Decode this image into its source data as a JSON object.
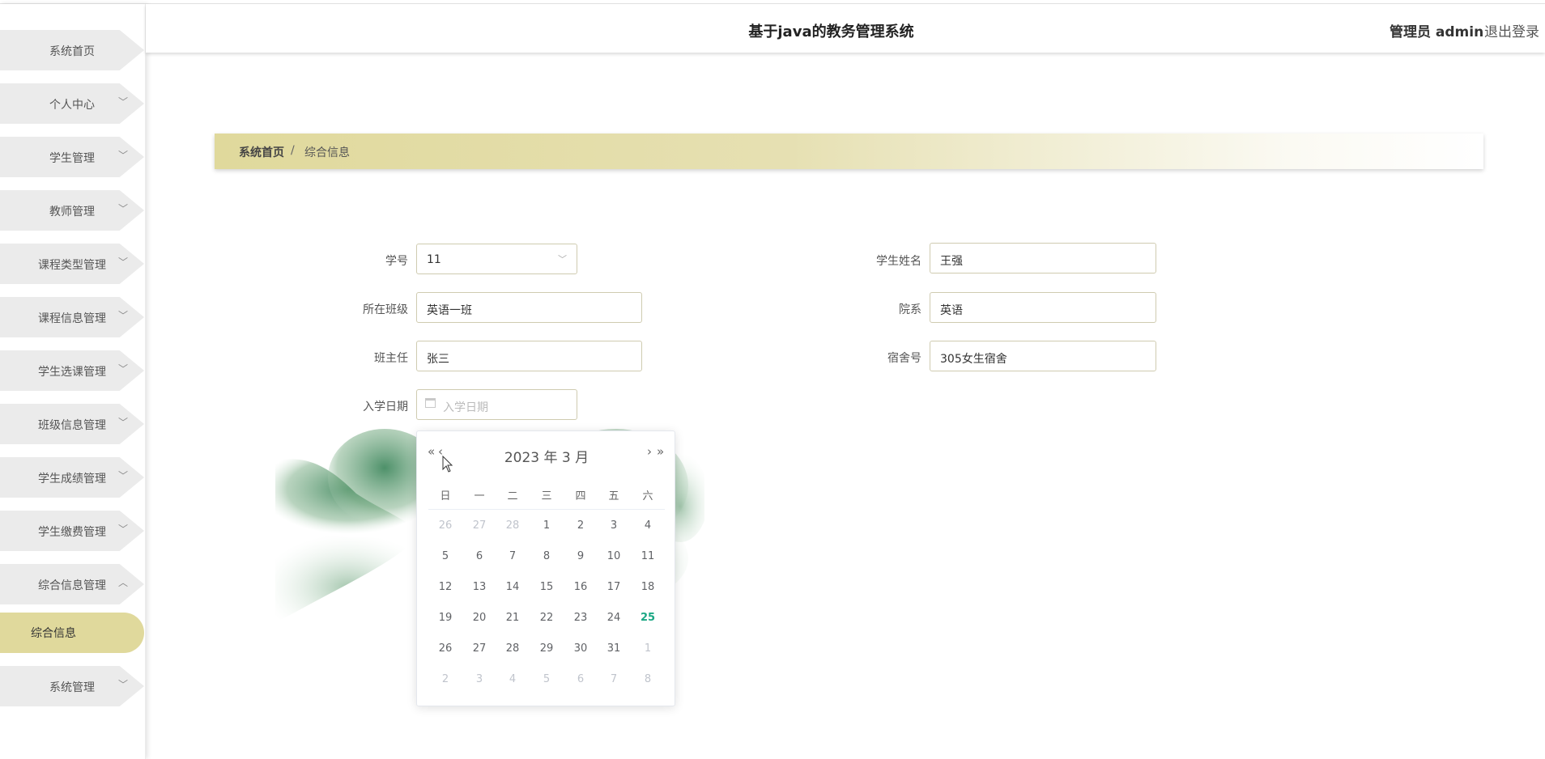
{
  "header": {
    "title": "基于java的教务管理系统",
    "user": "管理员 admin",
    "logout": "退出登录"
  },
  "sidebar": {
    "items": [
      {
        "label": "系统首页",
        "chevron": ""
      },
      {
        "label": "个人中心",
        "chevron": "﹀"
      },
      {
        "label": "学生管理",
        "chevron": "﹀"
      },
      {
        "label": "教师管理",
        "chevron": "﹀"
      },
      {
        "label": "课程类型管理",
        "chevron": "﹀"
      },
      {
        "label": "课程信息管理",
        "chevron": "﹀"
      },
      {
        "label": "学生选课管理",
        "chevron": "﹀"
      },
      {
        "label": "班级信息管理",
        "chevron": "﹀"
      },
      {
        "label": "学生成绩管理",
        "chevron": "﹀"
      },
      {
        "label": "学生缴费管理",
        "chevron": "﹀"
      },
      {
        "label": "综合信息管理",
        "chevron": "︿"
      },
      {
        "label": "系统管理",
        "chevron": "﹀"
      }
    ],
    "active_sub": "综合信息"
  },
  "breadcrumb": {
    "home": "系统首页",
    "sep": "/",
    "current": "综合信息"
  },
  "form": {
    "student_no": {
      "label": "学号",
      "value": "11"
    },
    "student_name": {
      "label": "学生姓名",
      "value": "王强"
    },
    "class": {
      "label": "所在班级",
      "value": "英语一班"
    },
    "department": {
      "label": "院系",
      "value": "英语"
    },
    "head_teacher": {
      "label": "班主任",
      "value": "张三"
    },
    "dorm": {
      "label": "宿舍号",
      "value": "305女生宿舍"
    },
    "enroll_date": {
      "label": "入学日期",
      "placeholder": "入学日期"
    }
  },
  "datepicker": {
    "prev_year": "«",
    "prev_month": "‹",
    "next_month": "›",
    "next_year": "»",
    "year_month": "2023 年  3 月",
    "weekdays": [
      "日",
      "一",
      "二",
      "三",
      "四",
      "五",
      "六"
    ],
    "weeks": [
      [
        "26",
        "27",
        "28",
        "1",
        "2",
        "3",
        "4"
      ],
      [
        "5",
        "6",
        "7",
        "8",
        "9",
        "10",
        "11"
      ],
      [
        "12",
        "13",
        "14",
        "15",
        "16",
        "17",
        "18"
      ],
      [
        "19",
        "20",
        "21",
        "22",
        "23",
        "24",
        "25"
      ],
      [
        "26",
        "27",
        "28",
        "29",
        "30",
        "31",
        "1"
      ],
      [
        "2",
        "3",
        "4",
        "5",
        "6",
        "7",
        "8"
      ]
    ],
    "today": "25"
  }
}
